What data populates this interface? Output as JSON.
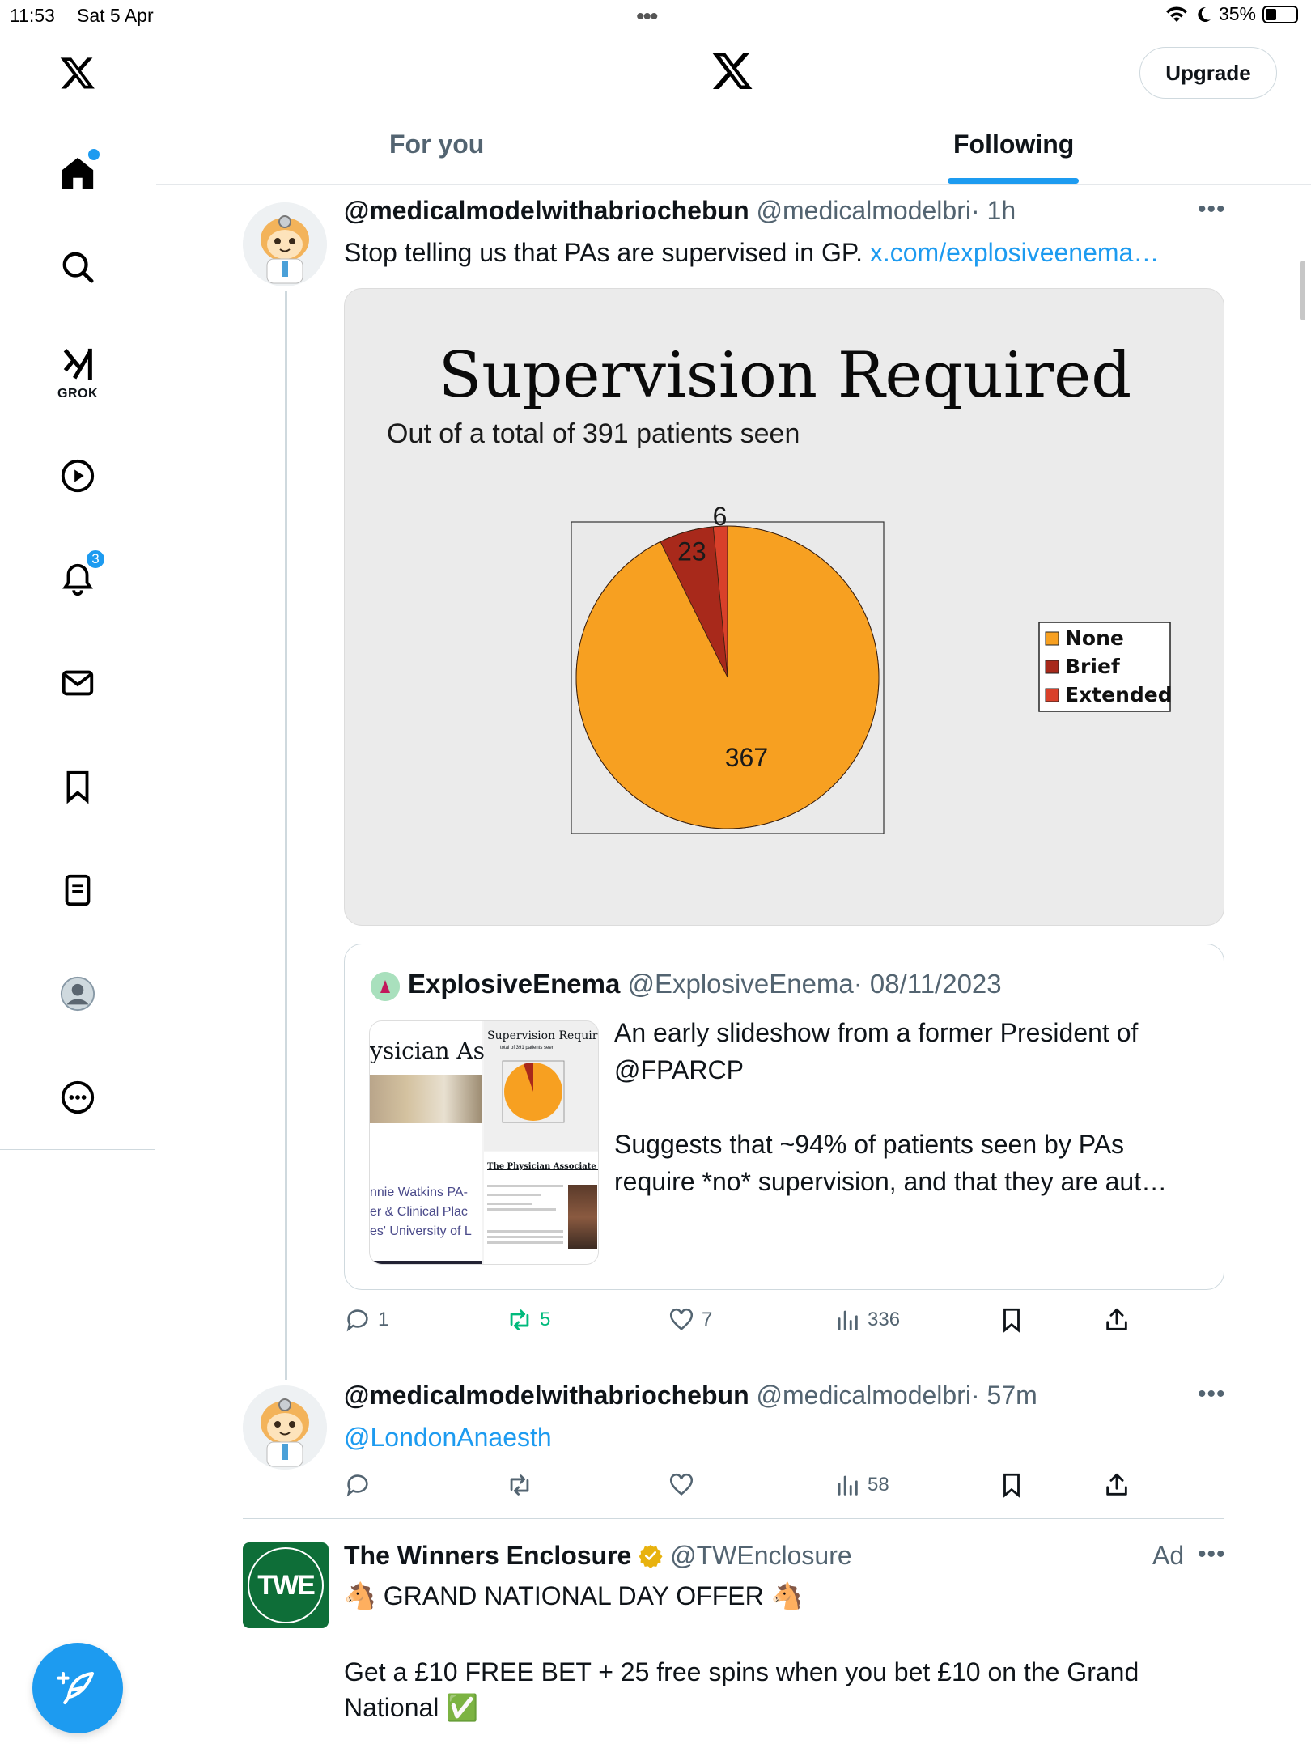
{
  "status_bar": {
    "time": "11:53",
    "date": "Sat 5 Apr",
    "battery": "35%"
  },
  "sidebar": {
    "grok_label": "GROK",
    "notifications_count": "3",
    "nav_icons": [
      "x-logo-icon",
      "home-icon",
      "search-icon",
      "grok-icon",
      "video-icon",
      "notifications-icon",
      "messages-icon",
      "bookmarks-icon",
      "lists-icon",
      "profile-icon",
      "more-icon"
    ]
  },
  "header": {
    "upgrade_label": "Upgrade",
    "tabs": [
      {
        "label": "For you"
      },
      {
        "label": "Following"
      }
    ]
  },
  "tweets": [
    {
      "display_name": "@medicalmodelwithabriochebun",
      "handle": "@medicalmodelbri",
      "time": "· 1h",
      "text": "Stop telling us that PAs are supervised in GP.",
      "link_text": "x.com/explosiveenema…",
      "quote": {
        "display_name": "ExplosiveEnema",
        "handle": "@ExplosiveEnema",
        "date": "· 08/11/2023",
        "text": "An early slideshow from a former President of\n@FPARCP\n\nSuggests that ~94% of patients seen by PAs\nrequire *no* supervision, and that they are aut…",
        "thumb_left_title": "ysician As",
        "thumb_left_lines": [
          "nnie Watkins PA-",
          "er & Clinical Plac",
          "es' University of L"
        ],
        "thumb_right_title": "Supervision Require",
        "thumb_right_sub": "total of 391 patients seen",
        "thumb_right_heading": "The Physician Associate Rol"
      },
      "actions": {
        "replies": "1",
        "reposts": "5",
        "likes": "7",
        "views": "336"
      }
    },
    {
      "display_name": "@medicalmodelwithabriochebun",
      "handle": "@medicalmodelbri",
      "time": "· 57m",
      "mention": "@LondonAnaesth",
      "actions": {
        "views": "58"
      }
    },
    {
      "display_name": "The Winners Enclosure",
      "handle": "@TWEnclosure",
      "ad_label": "Ad",
      "logo_text": "TWE",
      "line1": "🐴 GRAND NATIONAL DAY OFFER 🐴",
      "line2": "Get a £10 FREE BET + 25 free spins when you bet £10 on the Grand",
      "line3": "National ✅"
    }
  ],
  "chart_data": {
    "type": "pie",
    "title": "Supervision Required",
    "subtitle": "Out of a total of 391 patients seen",
    "categories": [
      "None",
      "Brief",
      "Extended"
    ],
    "values": [
      367,
      23,
      6
    ],
    "colors": [
      "#f7a021",
      "#a8291b",
      "#d9402a"
    ],
    "legend_position": "right"
  }
}
